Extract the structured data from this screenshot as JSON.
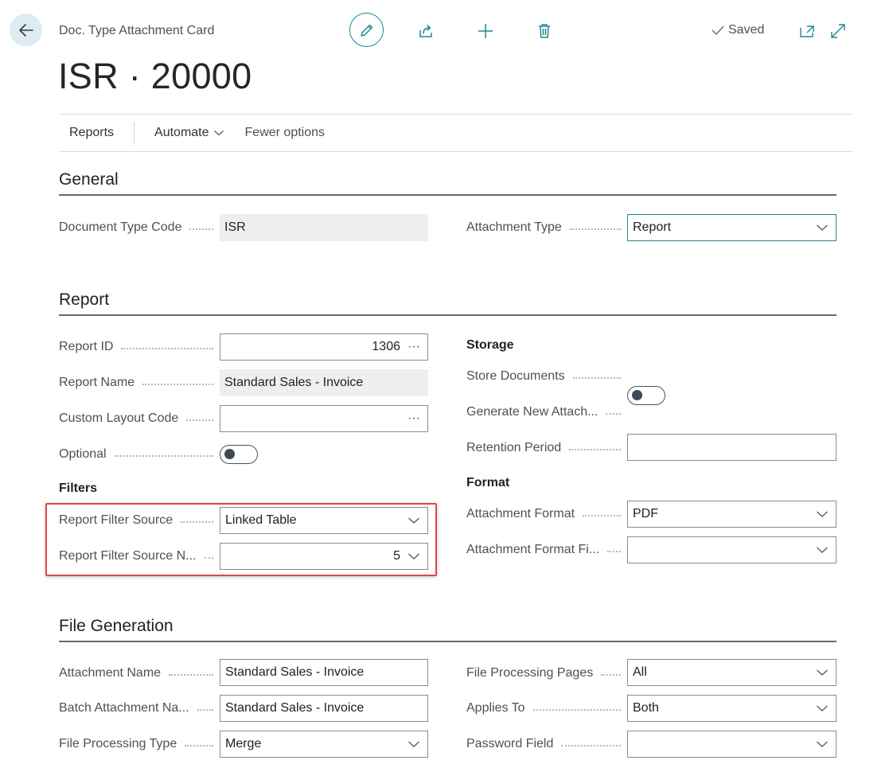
{
  "header": {
    "breadcrumb": "Doc. Type Attachment Card",
    "title": "ISR · 20000",
    "saved": "Saved"
  },
  "action_bar": {
    "items": [
      "Reports",
      "Automate",
      "Fewer options"
    ]
  },
  "general": {
    "title": "General",
    "document_type_code": {
      "label": "Document Type Code",
      "value": "ISR"
    },
    "attachment_type": {
      "label": "Attachment Type",
      "value": "Report"
    }
  },
  "report": {
    "title": "Report",
    "report_id": {
      "label": "Report ID",
      "value": "1306"
    },
    "report_name": {
      "label": "Report Name",
      "value": "Standard Sales - Invoice"
    },
    "custom_layout_code": {
      "label": "Custom Layout Code",
      "value": ""
    },
    "optional": {
      "label": "Optional",
      "value": false
    },
    "filters_title": "Filters",
    "report_filter_source": {
      "label": "Report Filter Source",
      "value": "Linked Table"
    },
    "report_filter_source_no": {
      "label": "Report Filter Source N...",
      "value": "5"
    },
    "storage_title": "Storage",
    "store_documents": {
      "label": "Store Documents",
      "value": false
    },
    "generate_new_attach": {
      "label": "Generate New Attach...",
      "value": false
    },
    "retention_period": {
      "label": "Retention Period",
      "value": ""
    },
    "format_title": "Format",
    "attachment_format": {
      "label": "Attachment Format",
      "value": "PDF"
    },
    "attachment_format_fi": {
      "label": "Attachment Format Fi...",
      "value": ""
    }
  },
  "file_generation": {
    "title": "File Generation",
    "attachment_name": {
      "label": "Attachment Name",
      "value": "Standard Sales - Invoice"
    },
    "batch_attachment_name": {
      "label": "Batch Attachment Na...",
      "value": "Standard Sales - Invoice"
    },
    "file_processing_type": {
      "label": "File Processing Type",
      "value": "Merge"
    },
    "file_processing_pages": {
      "label": "File Processing Pages",
      "value": "All"
    },
    "applies_to": {
      "label": "Applies To",
      "value": "Both"
    },
    "password_field": {
      "label": "Password Field",
      "value": ""
    }
  },
  "icons": {
    "back": "arrow-left-icon",
    "edit": "pencil-icon",
    "share": "share-icon",
    "new": "plus-icon",
    "delete": "trash-icon",
    "saved": "checkmark-icon",
    "open_new_window": "open-new-window-icon",
    "expand": "expand-icon",
    "dropdown": "chevron-down-icon",
    "lookup": "ellipsis-icon"
  },
  "colors": {
    "accent": "#1a8a8f",
    "highlight_border": "#e0454f"
  }
}
